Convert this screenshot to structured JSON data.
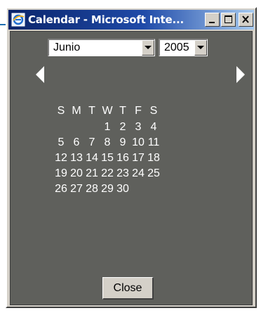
{
  "window": {
    "title": "Calendar - Microsoft Inte..."
  },
  "controls": {
    "month": "Junio",
    "year": "2005",
    "close_label": "Close"
  },
  "calendar": {
    "weekday_headers": [
      "S",
      "M",
      "T",
      "W",
      "T",
      "F",
      "S"
    ],
    "weeks": [
      [
        "",
        "",
        "",
        "1",
        "2",
        "3",
        "4"
      ],
      [
        "5",
        "6",
        "7",
        "8",
        "9",
        "10",
        "11"
      ],
      [
        "12",
        "13",
        "14",
        "15",
        "16",
        "17",
        "18"
      ],
      [
        "19",
        "20",
        "21",
        "22",
        "23",
        "24",
        "25"
      ],
      [
        "26",
        "27",
        "28",
        "29",
        "30",
        "",
        ""
      ]
    ]
  },
  "icons": {
    "title_icon": "ie-icon",
    "prev": "triangle-left-icon",
    "next": "triangle-right-icon",
    "dropdown": "chevron-down-icon"
  },
  "colors": {
    "titlebar_start": "#0a246a",
    "titlebar_end": "#a6caf0",
    "client_background": "#5f605c",
    "calendar_text": "#ffffff"
  }
}
